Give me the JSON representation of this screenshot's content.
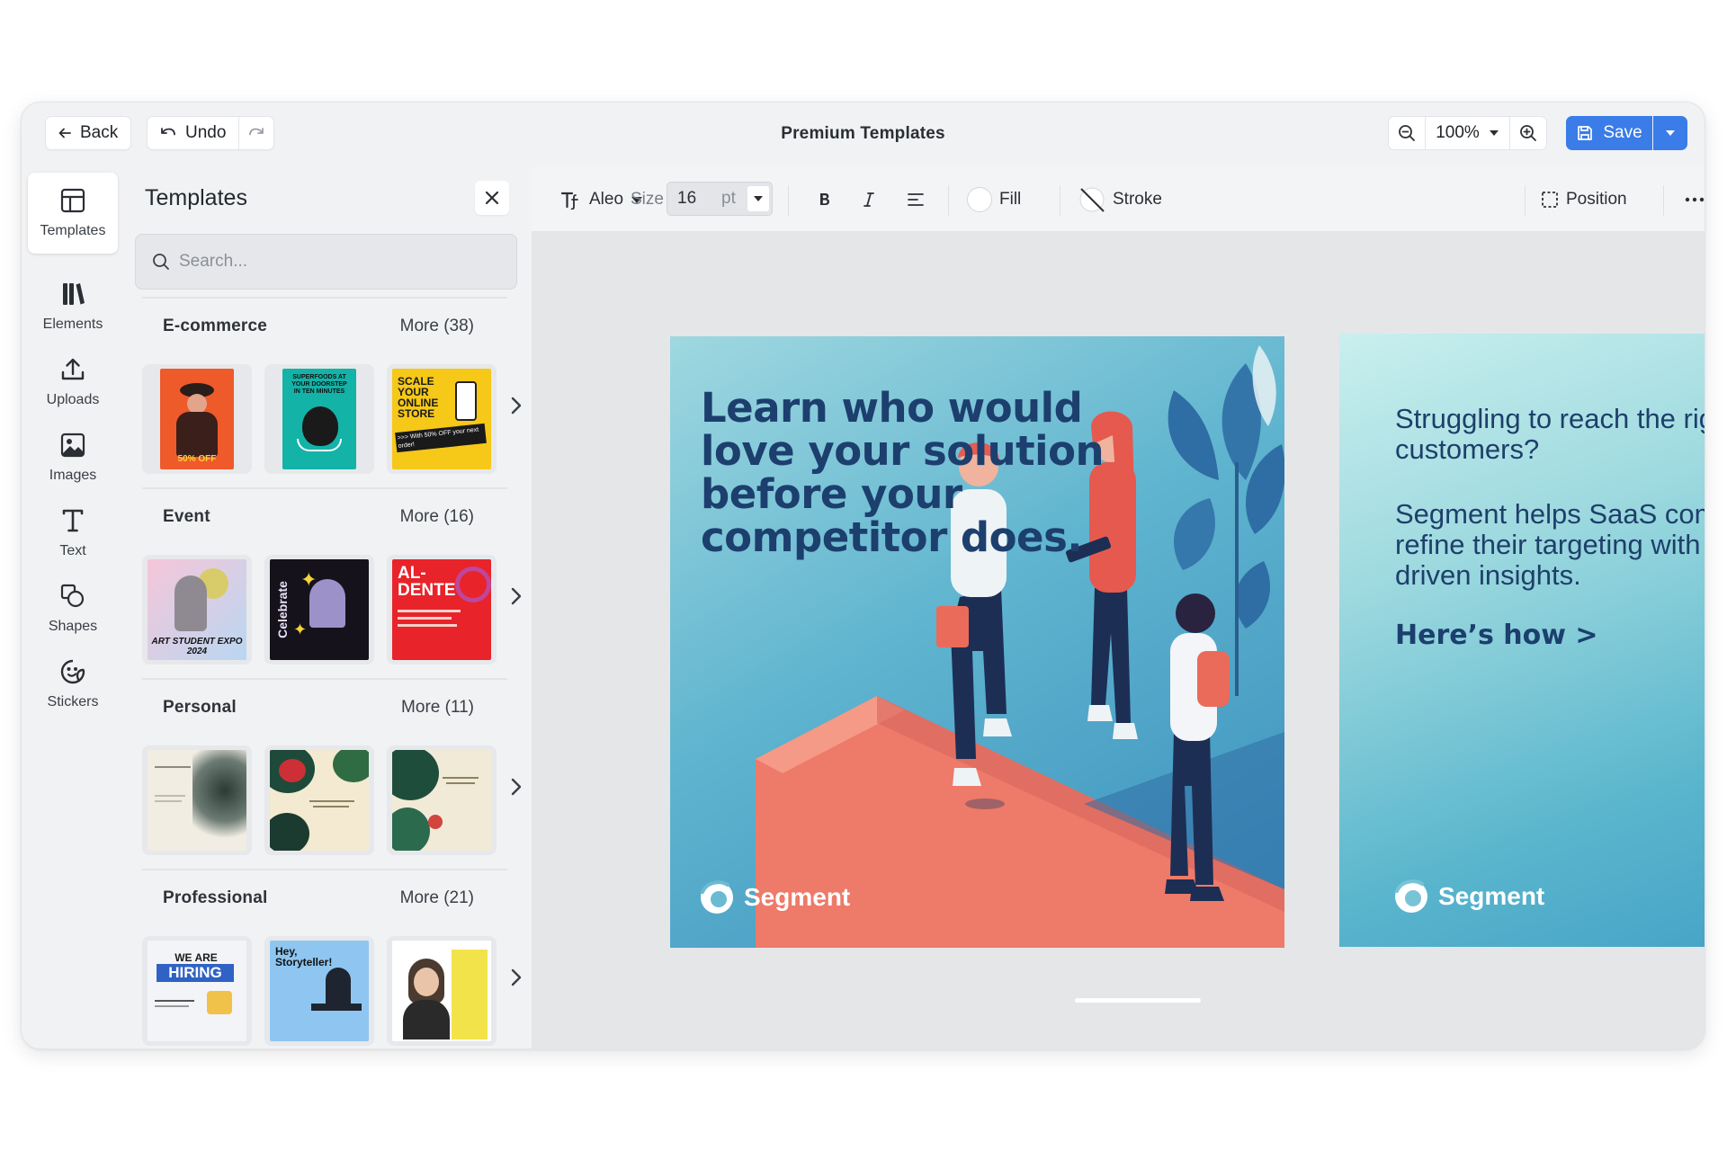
{
  "topbar": {
    "back_label": "Back",
    "undo_label": "Undo",
    "title": "Premium Templates",
    "zoom": "100%",
    "save_label": "Save"
  },
  "rail": {
    "items": [
      {
        "label": "Templates",
        "icon": "layout-icon"
      },
      {
        "label": "Elements",
        "icon": "elements-icon"
      },
      {
        "label": "Uploads",
        "icon": "upload-icon"
      },
      {
        "label": "Images",
        "icon": "image-icon"
      },
      {
        "label": "Text",
        "icon": "text-icon"
      },
      {
        "label": "Shapes",
        "icon": "shapes-icon"
      },
      {
        "label": "Stickers",
        "icon": "sticker-icon"
      }
    ]
  },
  "panel": {
    "title": "Templates",
    "search_placeholder": "Search...",
    "sections": [
      {
        "title": "E-commerce",
        "more": "More (38)"
      },
      {
        "title": "Event",
        "more": "More (16)"
      },
      {
        "title": "Personal",
        "more": "More (11)"
      },
      {
        "title": "Professional",
        "more": "More (21)"
      }
    ],
    "thumb_text": {
      "scale": "SCALE YOUR ONLINE STORE",
      "scale_sub": ">>> With 50% OFF your next order!",
      "superfoods": "SUPERFOODS AT YOUR DOORSTEP IN TEN MINUTES",
      "off": "50% OFF",
      "expo": "ART STUDENT EXPO 2024",
      "celebrate": "Celebrate",
      "aldente": "AL-DENTE",
      "hiring_top": "WE ARE",
      "hiring": "HIRING",
      "story": "Hey, Storyteller!"
    }
  },
  "toolbar": {
    "font": "Aleo",
    "size_label": "Size",
    "size_value": "16",
    "size_unit": "pt",
    "fill_label": "Fill",
    "stroke_label": "Stroke",
    "position_label": "Position"
  },
  "canvas": {
    "slide1": {
      "headline": "Learn who would love your solution before your competitor does.",
      "brand": "Segment"
    },
    "slide2": {
      "line1": "Struggling to reach the rig",
      "line2": "customers?",
      "line3": "Segment helps SaaS comp",
      "line4": "refine their targeting with",
      "line5": "driven insights.",
      "cta": "Here’s how >",
      "brand": "Segment"
    }
  },
  "colors": {
    "accent": "#3a7ce8",
    "headline": "#1c3f6e",
    "slide_bg": "#5fb4cf",
    "coral": "#ef7b6c"
  }
}
